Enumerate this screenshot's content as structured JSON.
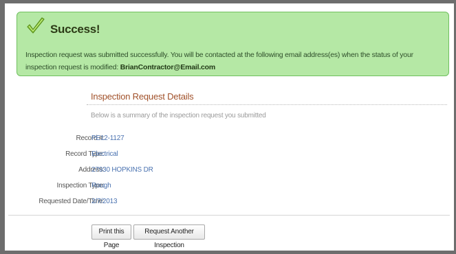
{
  "success": {
    "title": "Success!",
    "message": "Inspection request was submitted successfully. You will be contacted at the following email address(es) when the status of your inspection request is modified:",
    "email": "BrianContractor@Email.com"
  },
  "details": {
    "title": "Inspection Request Details",
    "description": "Below is a summary of the inspection request you submitted",
    "rows": [
      {
        "label": "Record #:",
        "value": "PE12-1127"
      },
      {
        "label": "Record Type:",
        "value": "Electrical"
      },
      {
        "label": "Address:",
        "value": "27930 HOPKINS DR"
      },
      {
        "label": "Inspection Type:",
        "value": "Rough"
      },
      {
        "label": "Requested Date/Time:",
        "value": "2/7/2013"
      }
    ]
  },
  "buttons": {
    "print": "Print this Page",
    "request_another": "Request Another Inspection"
  },
  "colors": {
    "success_bg": "#b5e8a5",
    "success_border": "#6fbf5e",
    "section_title": "#a1512a",
    "link": "#4a72b0"
  },
  "icons": {
    "success": "checkmark-icon"
  }
}
